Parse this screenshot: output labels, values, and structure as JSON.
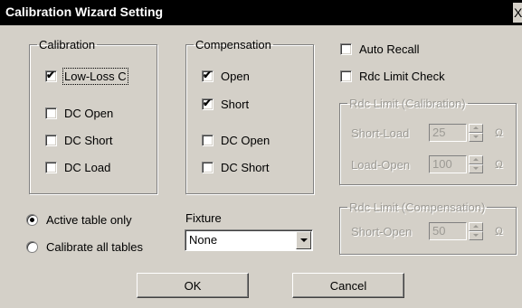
{
  "window": {
    "title": "Calibration Wizard Setting",
    "close_glyph": "X"
  },
  "calibration": {
    "legend": "Calibration",
    "items": [
      {
        "label": "Low-Loss C",
        "checked": true,
        "check_glyph": "✔"
      },
      {
        "label": "DC Open",
        "checked": false,
        "check_glyph": ""
      },
      {
        "label": "DC Short",
        "checked": false,
        "check_glyph": ""
      },
      {
        "label": "DC Load",
        "checked": false,
        "check_glyph": ""
      }
    ]
  },
  "compensation": {
    "legend": "Compensation",
    "items": [
      {
        "label": "Open",
        "checked": true,
        "check_glyph": "✔"
      },
      {
        "label": "Short",
        "checked": true,
        "check_glyph": "✔"
      },
      {
        "label": "DC Open",
        "checked": false,
        "check_glyph": ""
      },
      {
        "label": "DC Short",
        "checked": false,
        "check_glyph": ""
      }
    ]
  },
  "options": {
    "auto_recall": {
      "label": "Auto Recall",
      "checked": false
    },
    "rdc_limit_check": {
      "label": "Rdc Limit Check",
      "checked": false
    }
  },
  "rdc_limit_calibration": {
    "legend": "Rdc Limit (Calibration)",
    "short_load": {
      "label": "Short-Load",
      "value": "25",
      "unit": "Ω"
    },
    "load_open": {
      "label": "Load-Open",
      "value": "100",
      "unit": "Ω"
    }
  },
  "rdc_limit_compensation": {
    "legend": "Rdc Limit (Compensation)",
    "short_open": {
      "label": "Short-Open",
      "value": "50",
      "unit": "Ω"
    }
  },
  "table_scope": {
    "active_only": {
      "label": "Active table only",
      "selected": true
    },
    "all_tables": {
      "label": "Calibrate all tables",
      "selected": false
    }
  },
  "fixture": {
    "label": "Fixture",
    "selected": "None"
  },
  "buttons": {
    "ok": "OK",
    "cancel": "Cancel"
  }
}
